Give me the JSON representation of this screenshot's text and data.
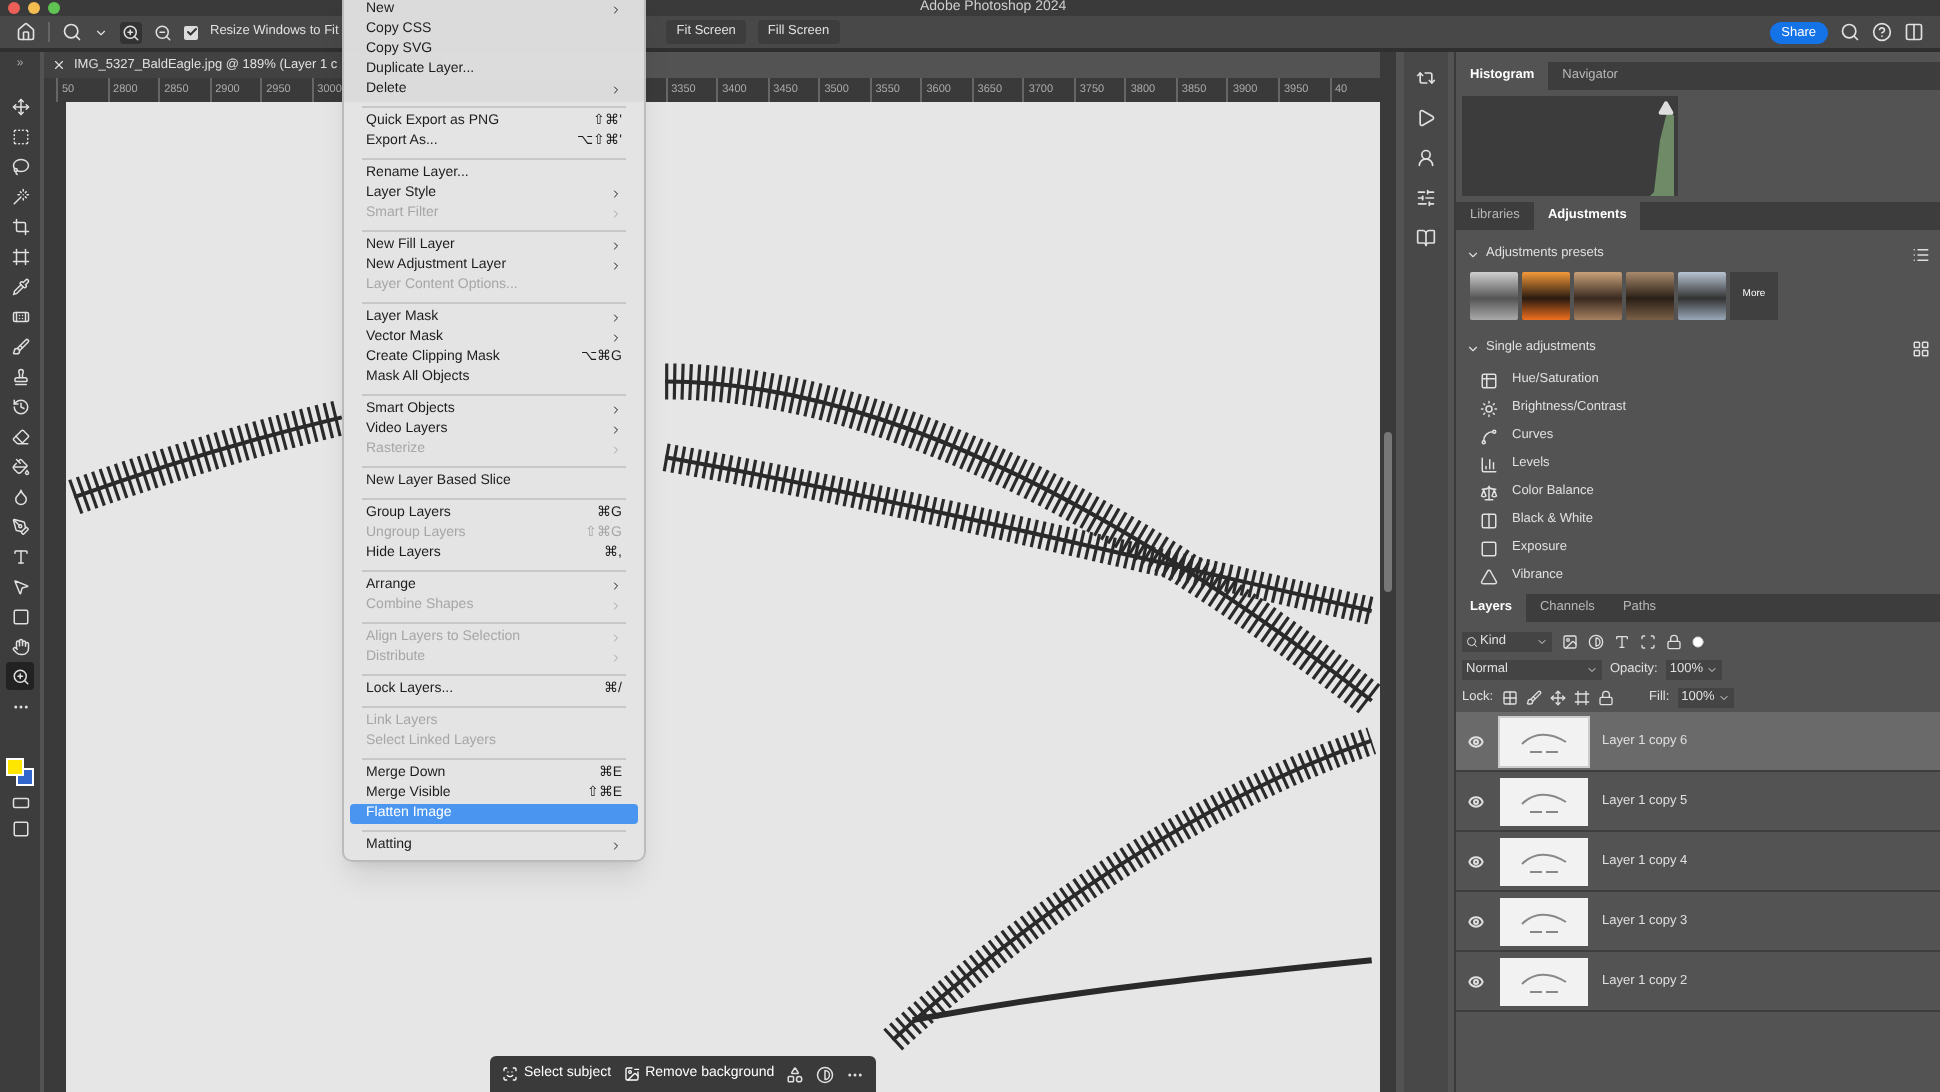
{
  "window": {
    "title": "Adobe Photoshop 2024"
  },
  "options_bar": {
    "resize_windows": {
      "label": "Resize Windows to Fit",
      "checked": true
    },
    "buttons": [
      "Fit Screen",
      "Fill Screen"
    ],
    "share": "Share"
  },
  "toolbar": {
    "collapse": "»",
    "tools": [
      {
        "selected": false
      },
      {
        "selected": false
      },
      {
        "selected": false
      },
      {
        "selected": false
      },
      {
        "selected": false
      },
      {
        "selected": false
      },
      {
        "selected": false
      },
      {
        "selected": false
      },
      {
        "selected": false
      },
      {
        "selected": false
      },
      {
        "selected": false
      },
      {
        "selected": false
      },
      {
        "selected": false
      },
      {
        "selected": false
      },
      {
        "selected": false
      },
      {
        "selected": false
      },
      {
        "selected": false
      },
      {
        "selected": false
      },
      {
        "selected": false
      },
      {
        "selected": true
      },
      {
        "selected": false
      }
    ]
  },
  "document_tab": {
    "title": "IMG_5327_BaldEagle.jpg @ 189% (Layer 1 c"
  },
  "ruler": {
    "left_labels": [
      "50",
      "2800",
      "2850",
      "2900",
      "2950",
      "3000"
    ],
    "right_labels": [
      "3350",
      "3400",
      "3450",
      "3500",
      "3550",
      "3600",
      "3650",
      "3700",
      "3750",
      "3800",
      "3850",
      "3900",
      "3950",
      "40"
    ]
  },
  "context_menu": {
    "items": [
      {
        "kind": "item",
        "label": "New",
        "submenu": true,
        "disabled": false,
        "selected": false
      },
      {
        "kind": "item",
        "label": "Copy CSS",
        "submenu": false,
        "disabled": false,
        "selected": false
      },
      {
        "kind": "item",
        "label": "Copy SVG",
        "submenu": false,
        "disabled": false,
        "selected": false
      },
      {
        "kind": "item",
        "label": "Duplicate Layer...",
        "submenu": false,
        "disabled": false,
        "selected": false
      },
      {
        "kind": "item",
        "label": "Delete",
        "submenu": true,
        "disabled": false,
        "selected": false
      },
      {
        "kind": "separator"
      },
      {
        "kind": "item",
        "label": "Quick Export as PNG",
        "shortcut": "⇧⌘'",
        "submenu": false,
        "disabled": false,
        "selected": false
      },
      {
        "kind": "item",
        "label": "Export As...",
        "shortcut": "⌥⇧⌘'",
        "submenu": false,
        "disabled": false,
        "selected": false
      },
      {
        "kind": "separator"
      },
      {
        "kind": "item",
        "label": "Rename Layer...",
        "submenu": false,
        "disabled": false,
        "selected": false
      },
      {
        "kind": "item",
        "label": "Layer Style",
        "submenu": true,
        "disabled": false,
        "selected": false
      },
      {
        "kind": "item",
        "label": "Smart Filter",
        "submenu": true,
        "disabled": true,
        "selected": false
      },
      {
        "kind": "separator"
      },
      {
        "kind": "item",
        "label": "New Fill Layer",
        "submenu": true,
        "disabled": false,
        "selected": false
      },
      {
        "kind": "item",
        "label": "New Adjustment Layer",
        "submenu": true,
        "disabled": false,
        "selected": false
      },
      {
        "kind": "item",
        "label": "Layer Content Options...",
        "submenu": false,
        "disabled": true,
        "selected": false
      },
      {
        "kind": "separator"
      },
      {
        "kind": "item",
        "label": "Layer Mask",
        "submenu": true,
        "disabled": false,
        "selected": false
      },
      {
        "kind": "item",
        "label": "Vector Mask",
        "submenu": true,
        "disabled": false,
        "selected": false
      },
      {
        "kind": "item",
        "label": "Create Clipping Mask",
        "shortcut": "⌥⌘G",
        "submenu": false,
        "disabled": false,
        "selected": false
      },
      {
        "kind": "item",
        "label": "Mask All Objects",
        "submenu": false,
        "disabled": false,
        "selected": false
      },
      {
        "kind": "separator"
      },
      {
        "kind": "item",
        "label": "Smart Objects",
        "submenu": true,
        "disabled": false,
        "selected": false
      },
      {
        "kind": "item",
        "label": "Video Layers",
        "submenu": true,
        "disabled": false,
        "selected": false
      },
      {
        "kind": "item",
        "label": "Rasterize",
        "submenu": true,
        "disabled": true,
        "selected": false
      },
      {
        "kind": "separator"
      },
      {
        "kind": "item",
        "label": "New Layer Based Slice",
        "submenu": false,
        "disabled": false,
        "selected": false
      },
      {
        "kind": "separator"
      },
      {
        "kind": "item",
        "label": "Group Layers",
        "shortcut": "⌘G",
        "submenu": false,
        "disabled": false,
        "selected": false
      },
      {
        "kind": "item",
        "label": "Ungroup Layers",
        "shortcut": "⇧⌘G",
        "submenu": false,
        "disabled": true,
        "selected": false
      },
      {
        "kind": "item",
        "label": "Hide Layers",
        "shortcut": "⌘,",
        "submenu": false,
        "disabled": false,
        "selected": false
      },
      {
        "kind": "separator"
      },
      {
        "kind": "item",
        "label": "Arrange",
        "submenu": true,
        "disabled": false,
        "selected": false
      },
      {
        "kind": "item",
        "label": "Combine Shapes",
        "submenu": true,
        "disabled": true,
        "selected": false
      },
      {
        "kind": "separator"
      },
      {
        "kind": "item",
        "label": "Align Layers to Selection",
        "submenu": true,
        "disabled": true,
        "selected": false
      },
      {
        "kind": "item",
        "label": "Distribute",
        "submenu": true,
        "disabled": true,
        "selected": false
      },
      {
        "kind": "separator"
      },
      {
        "kind": "item",
        "label": "Lock Layers...",
        "shortcut": "⌘/",
        "submenu": false,
        "disabled": false,
        "selected": false
      },
      {
        "kind": "separator"
      },
      {
        "kind": "item",
        "label": "Link Layers",
        "submenu": false,
        "disabled": true,
        "selected": false
      },
      {
        "kind": "item",
        "label": "Select Linked Layers",
        "submenu": false,
        "disabled": true,
        "selected": false
      },
      {
        "kind": "separator"
      },
      {
        "kind": "item",
        "label": "Merge Down",
        "shortcut": "⌘E",
        "submenu": false,
        "disabled": false,
        "selected": false
      },
      {
        "kind": "item",
        "label": "Merge Visible",
        "shortcut": "⇧⌘E",
        "submenu": false,
        "disabled": false,
        "selected": false
      },
      {
        "kind": "item",
        "label": "Flatten Image",
        "submenu": false,
        "disabled": false,
        "selected": true
      },
      {
        "kind": "separator"
      },
      {
        "kind": "item",
        "label": "Matting",
        "submenu": true,
        "disabled": false,
        "selected": false
      }
    ]
  },
  "task_bar": {
    "buttons": [
      "Select subject",
      "Remove background"
    ]
  },
  "histogram_tabs": [
    {
      "label": "Histogram",
      "selected": true
    },
    {
      "label": "Navigator",
      "selected": false
    }
  ],
  "adjustments_tabs": [
    {
      "label": "Libraries",
      "selected": false
    },
    {
      "label": "Adjustments",
      "selected": true
    }
  ],
  "adjustments": {
    "presets": {
      "title": "Adjustments presets",
      "expanded": true,
      "more": "More"
    },
    "single": {
      "title": "Single adjustments",
      "expanded": true
    },
    "items": [
      "Hue/Saturation",
      "Brightness/Contrast",
      "Curves",
      "Levels",
      "Color Balance",
      "Black & White",
      "Exposure",
      "Vibrance"
    ]
  },
  "layers_tabs": [
    {
      "label": "Layers",
      "selected": true
    },
    {
      "label": "Channels",
      "selected": false
    },
    {
      "label": "Paths",
      "selected": false
    }
  ],
  "layers_panel": {
    "filter": "Kind",
    "blend_mode": "Normal",
    "opacity_label": "Opacity:",
    "opacity": "100%",
    "lock_label": "Lock:",
    "fill_label": "Fill:",
    "fill": "100%",
    "layers": [
      {
        "name": "Layer 1 copy 6",
        "selected": true,
        "visible": true
      },
      {
        "name": "Layer 1 copy 5",
        "selected": false,
        "visible": true
      },
      {
        "name": "Layer 1 copy 4",
        "selected": false,
        "visible": true
      },
      {
        "name": "Layer 1 copy 3",
        "selected": false,
        "visible": true
      },
      {
        "name": "Layer 1 copy 2",
        "selected": false,
        "visible": true
      }
    ]
  }
}
